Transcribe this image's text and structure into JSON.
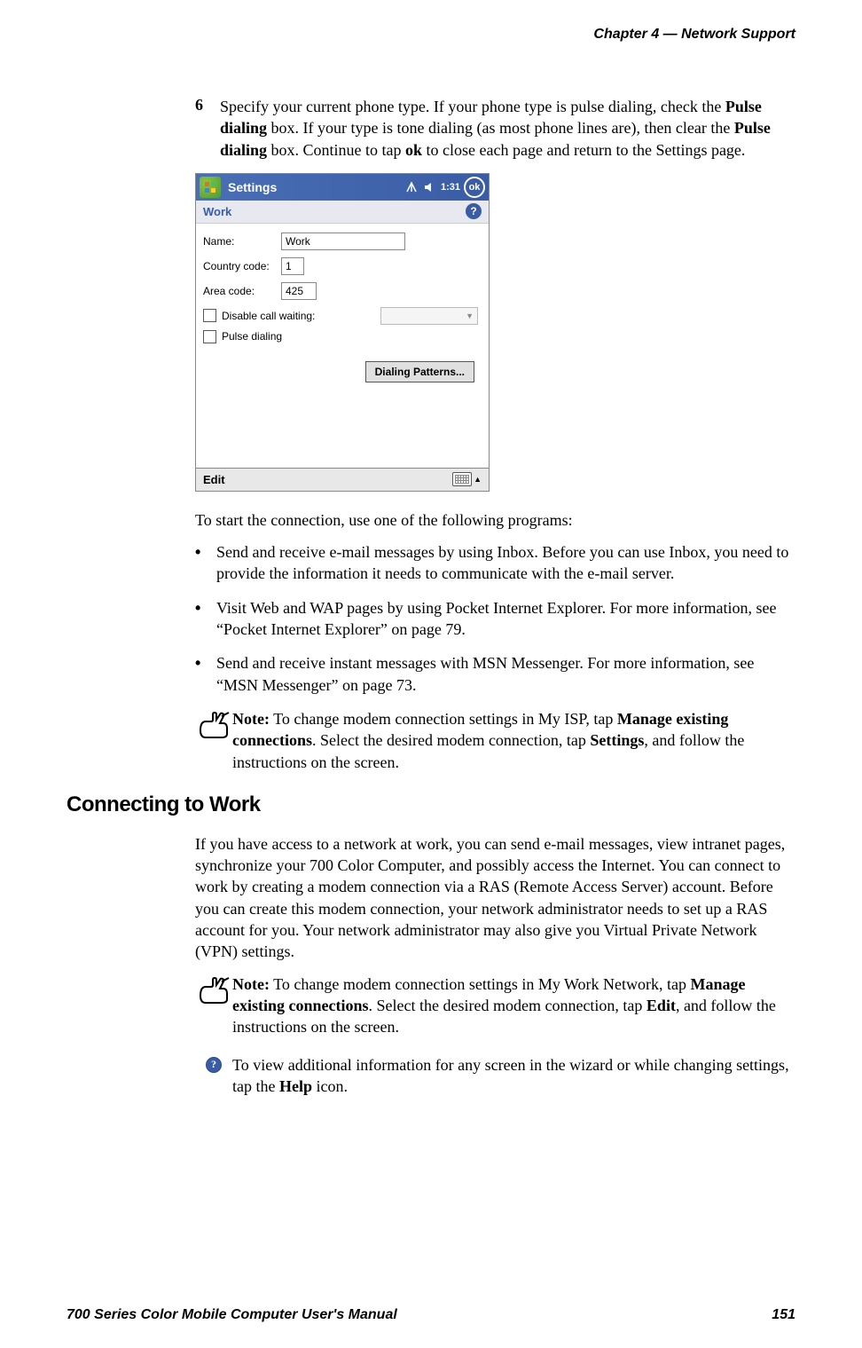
{
  "header": {
    "text": "Chapter 4  —  Network Support"
  },
  "step6": {
    "number": "6",
    "text_parts": [
      "Specify your current phone type. If your phone type is pulse dialing, check the ",
      "Pulse dialing",
      " box. If your type is tone dialing (as most phone lines are), then clear the ",
      "Pulse dialing",
      " box. Continue to tap ",
      "ok",
      " to close each page and return to the Settings page."
    ]
  },
  "screenshot": {
    "titlebar": {
      "title": "Settings",
      "time": "1:31",
      "ok": "ok"
    },
    "subheader": "Work",
    "fields": {
      "name_label": "Name:",
      "name_value": "Work",
      "country_label": "Country code:",
      "country_value": "1",
      "area_label": "Area code:",
      "area_value": "425",
      "disable_call_waiting": "Disable call waiting:",
      "pulse_dialing": "Pulse dialing"
    },
    "button": "Dialing Patterns...",
    "bottombar": "Edit"
  },
  "post_screenshot_para": "To start the connection, use one of the following programs:",
  "bullets": [
    "Send and receive e-mail messages by using Inbox. Before you can use Inbox, you need to provide the information it needs to communicate with the e-mail server.",
    "Visit Web and WAP pages by using Pocket Internet Explorer. For more information, see “Pocket Internet Explorer” on page 79.",
    "Send and receive instant messages with MSN Messenger. For more information, see “MSN Messenger” on page 73."
  ],
  "note1": {
    "label": "Note:",
    "p1": " To change modem connection settings in My ISP, tap ",
    "b1": "Manage existing connections",
    "p2": ". Select the desired modem connection, tap ",
    "b2": "Settings",
    "p3": ", and follow the instructions on the screen."
  },
  "section_heading": "Connecting to Work",
  "work_para": "If you have access to a network at work, you can send e-mail messages, view intranet pages, synchronize your 700 Color Computer, and possibly access the Internet. You can connect to work by creating a modem connection via a RAS (Remote Access Server) account. Before you can create this modem connection, your network administrator needs to set up a RAS account for you. Your network administrator may also give you Virtual Private Network (VPN) settings.",
  "note2": {
    "label": "Note:",
    "p1": " To change modem connection settings in My Work Network, tap ",
    "b1": "Manage existing connections",
    "p2": ". Select the desired modem connection, tap ",
    "b2": "Edit",
    "p3": ", and follow the instructions on the screen."
  },
  "help_note": {
    "p1": "To view additional information for any screen in the wizard or while changing settings, tap the ",
    "b1": "Help",
    "p2": " icon."
  },
  "footer": {
    "left": "700 Series Color Mobile Computer User's Manual",
    "right": "151"
  }
}
